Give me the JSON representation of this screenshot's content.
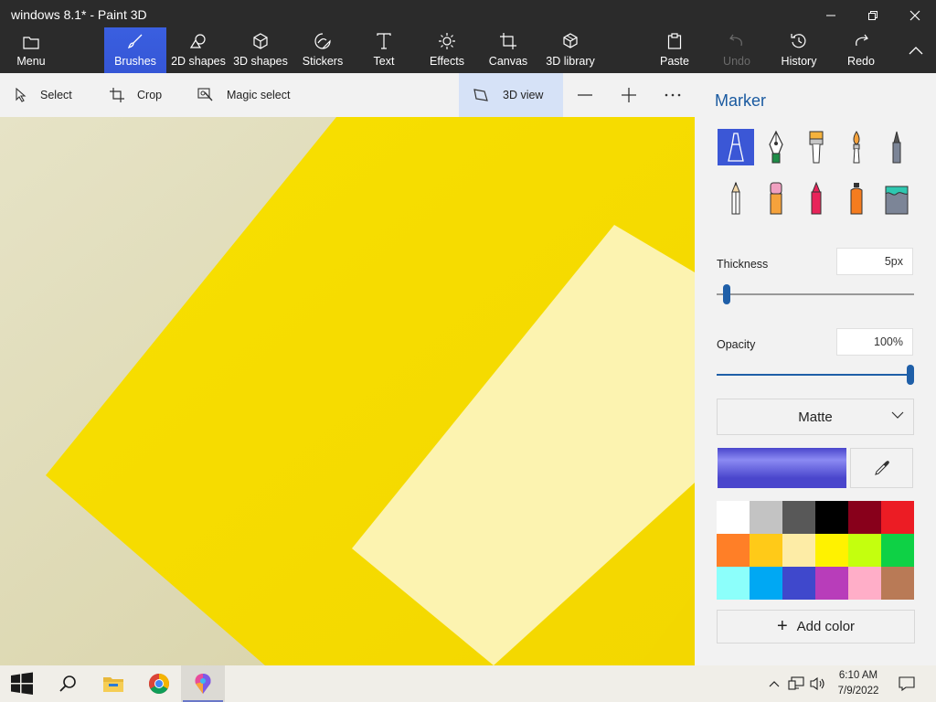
{
  "window": {
    "title": "windows 8.1* - Paint 3D",
    "controls": {
      "minimize": "minimize-icon",
      "maximize": "maximize-icon",
      "close": "close-icon"
    }
  },
  "ribbon": {
    "menu": "Menu",
    "brushes": "Brushes",
    "shapes2d": "2D shapes",
    "shapes3d": "3D shapes",
    "stickers": "Stickers",
    "text": "Text",
    "effects": "Effects",
    "canvas": "Canvas",
    "library3d": "3D library",
    "paste": "Paste",
    "undo": "Undo",
    "history": "History",
    "redo": "Redo",
    "active_tab": "Brushes",
    "accent": "#3556d6"
  },
  "toolbar": {
    "select": "Select",
    "crop": "Crop",
    "magic_select": "Magic select",
    "view3d": "3D view"
  },
  "panel": {
    "title": "Marker",
    "tools": [
      "marker-icon",
      "calligraphy-pen-icon",
      "oil-brush-icon",
      "watercolor-icon",
      "pixel-pen-icon",
      "pencil-icon",
      "eraser-icon",
      "crayon-icon",
      "spray-can-icon",
      "fill-bucket-icon"
    ],
    "selected_tool": "Marker",
    "thickness_label": "Thickness",
    "thickness_value": "5px",
    "thickness_fraction": 0.05,
    "opacity_label": "Opacity",
    "opacity_value": "100%",
    "opacity_fraction": 1.0,
    "finish": "Matte",
    "current_color": "#4a46cc",
    "palette": [
      "#ffffff",
      "#c3c3c3",
      "#585858",
      "#000000",
      "#88001b",
      "#ec1c24",
      "#ff7f27",
      "#ffca18",
      "#fdeca6",
      "#fff200",
      "#c4ff0e",
      "#0ed145",
      "#8cfffb",
      "#00a8f3",
      "#3f48cc",
      "#b83dba",
      "#ffaec8",
      "#b97a56"
    ],
    "add_color": "Add color"
  },
  "taskbar": {
    "apps": [
      "start-icon",
      "search-icon",
      "file-explorer-icon",
      "chrome-icon",
      "paint3d-icon"
    ],
    "active_app": "paint3d-icon",
    "time": "6:10 AM",
    "date": "7/9/2022"
  }
}
